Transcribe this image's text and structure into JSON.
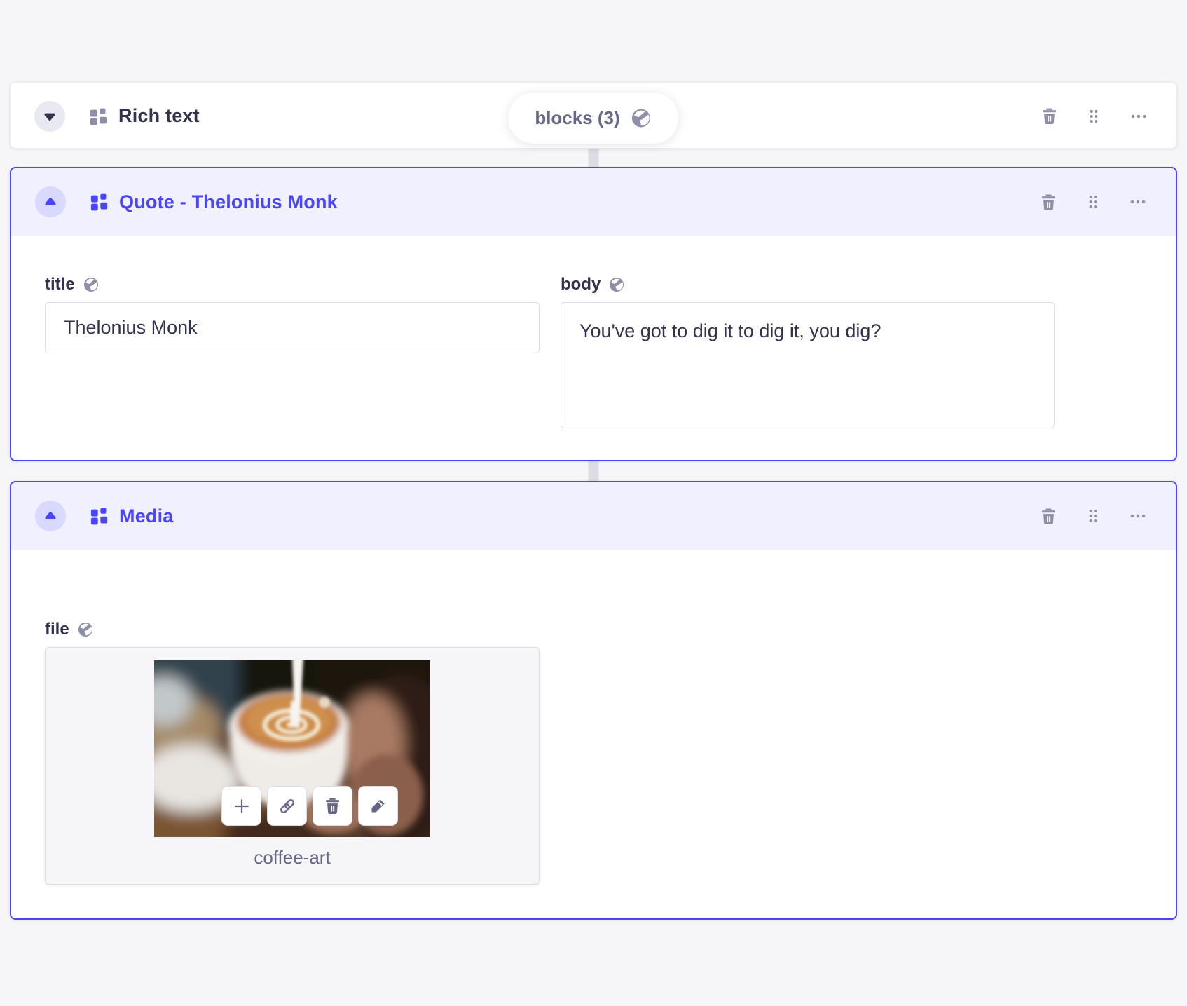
{
  "colors": {
    "accent": "#4945ff",
    "page_bg": "#f6f6f9",
    "selected_header_bg": "#f0f0ff",
    "selected_toggle_bg": "#d9d8ff",
    "icon_gray": "#8e8ea9",
    "text_dark": "#32324d",
    "text_muted": "#666687",
    "input_border": "#dcdce4",
    "block_border": "#eaeaef",
    "connector": "#dcdce4"
  },
  "icons": {
    "localized": "globe",
    "component": "blocks-grid",
    "collapse": "chevron-up-triangle",
    "expand": "chevron-down-triangle",
    "delete": "trash",
    "drag": "six-dots-handle",
    "more": "ellipsis",
    "media_actions": [
      "plus",
      "link",
      "trash",
      "pencil"
    ]
  },
  "zone_pill": {
    "label": "blocks (3)"
  },
  "blocks": {
    "rich_text": {
      "title": "Rich text",
      "state": "collapsed",
      "selected": false
    },
    "quote": {
      "title": "Quote - Thelonius Monk",
      "state": "expanded",
      "selected": true,
      "fields": {
        "title": {
          "label": "title",
          "value": "Thelonius Monk",
          "localized": true
        },
        "body": {
          "label": "body",
          "value": "You've got to dig it to dig it, you dig?",
          "localized": true
        }
      }
    },
    "media": {
      "title": "Media",
      "state": "expanded",
      "selected": true,
      "fields": {
        "file": {
          "label": "file",
          "filename": "coffee-art",
          "localized": true
        }
      }
    }
  }
}
